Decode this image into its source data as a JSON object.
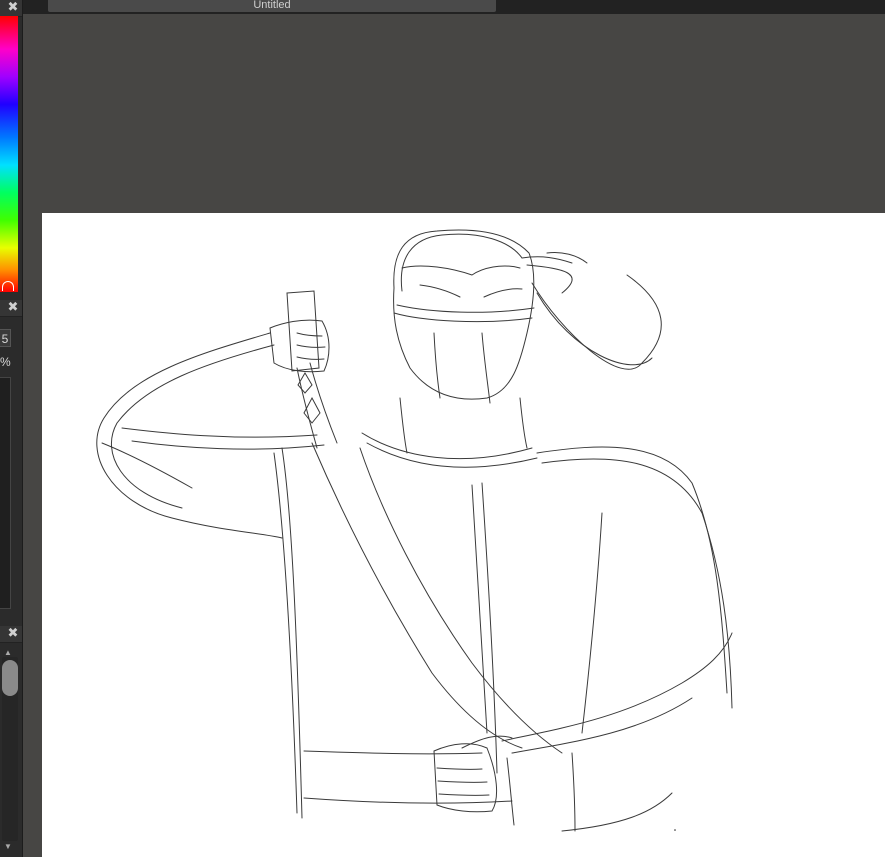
{
  "document": {
    "tab_title": "Untitled"
  },
  "left_panel": {
    "brush_size_value": "5",
    "opacity_label": "%",
    "close_icon_glyph": "✖"
  },
  "colors": {
    "workspace_bg": "#474644",
    "panel_bg": "#2b2b2b",
    "canvas_bg": "#ffffff",
    "sketch_stroke": "#3a3a3a"
  },
  "icons": [
    "close-icon",
    "scroll-up-arrow-icon",
    "scroll-down-arrow-icon"
  ]
}
